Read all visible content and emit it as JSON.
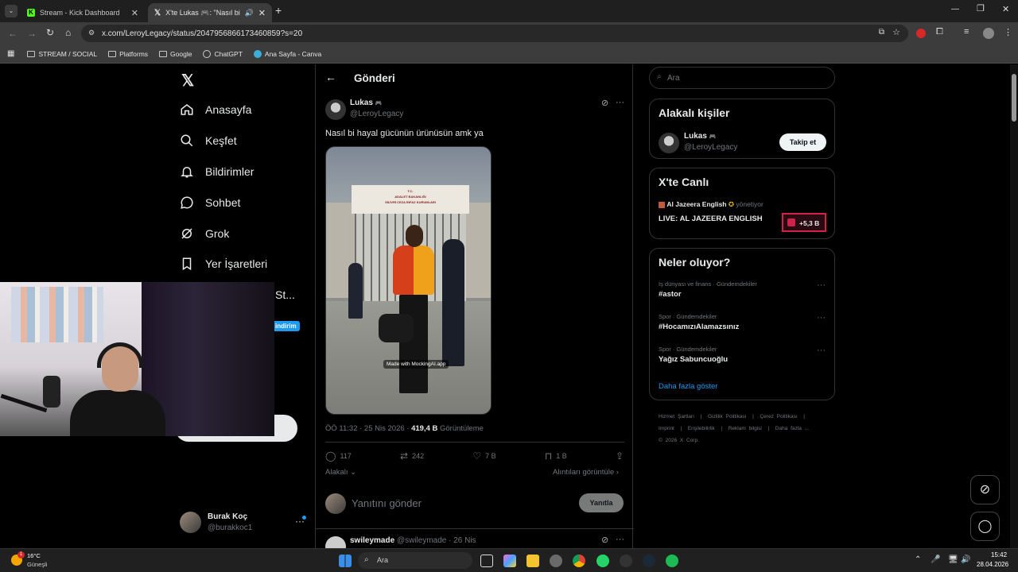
{
  "browser": {
    "tabs": [
      {
        "title": "Stream - Kick Dashboard",
        "active": false
      },
      {
        "title": "X'te Lukas 🎮: \"Nasıl bi hay",
        "active": true
      }
    ],
    "url": "x.com/LeroyLegacy/status/2047956866173460859?s=20",
    "bookmarks": [
      "STREAM / SOCIAL",
      "Platforms",
      "Google",
      "ChatGPT",
      "Ana Sayfa - Canva"
    ]
  },
  "sidebar": {
    "items": [
      {
        "label": "Anasayfa",
        "icon": "home-icon"
      },
      {
        "label": "Keşfet",
        "icon": "search-icon"
      },
      {
        "label": "Bildirimler",
        "icon": "bell-icon"
      },
      {
        "label": "Sohbet",
        "icon": "chat-icon"
      },
      {
        "label": "Grok",
        "icon": "grok-icon"
      },
      {
        "label": "Yer İşaretleri",
        "icon": "bookmark-icon"
      }
    ],
    "partial_label": "St...",
    "discount_badge": "indirim",
    "account": {
      "name": "Burak Koç",
      "handle": "@burakkoc1"
    }
  },
  "post": {
    "header": "Gönderi",
    "author": "Lukas",
    "author_emoji": "🎮",
    "handle": "@LeroyLegacy",
    "text": "Nasıl bi hayal gücünün ürünüsün amk ya",
    "image_sign_lines": [
      "T.C.",
      "ADALET BAKANLIĞI",
      "SİLİVRİ CEZA İNFAZ KURUMLARI"
    ],
    "watermark": "Made with MockingAI.app",
    "time": "ÖÖ 11:32 · 25 Nis 2026 · ",
    "views": "419,4 B",
    "views_label": " Görüntüleme",
    "replies": "117",
    "reposts": "242",
    "likes": "7 B",
    "bookmarks": "1 B",
    "relevant_label": "Alakalı",
    "quotes_label": "Alıntıları görüntüle",
    "reply_placeholder": "Yanıtını gönder",
    "reply_button": "Yanıtla",
    "next_reply": {
      "author": "swileymade",
      "handle": "@swileymade",
      "date": "· 26 Nis"
    }
  },
  "right": {
    "search_placeholder": "Ara",
    "related_title": "Alakalı kişiler",
    "related_person": {
      "name": "Lukas",
      "handle": "@LeroyLegacy",
      "button": "Takip et"
    },
    "live_title": "X'te Canlı",
    "live": {
      "channel": "Al Jazeera English",
      "role": "yönetiyor",
      "title": "LIVE: AL JAZEERA ENGLISH",
      "viewers": "+5,3 B"
    },
    "trends_title": "Neler oluyor?",
    "trends": [
      {
        "category": "İş dünyası ve finans · Gündemdekiler",
        "tag": "#astor"
      },
      {
        "category": "Spor · Gündemdekiler",
        "tag": "#HocamızıAlamazsınız"
      },
      {
        "category": "Spor · Gündemdekiler",
        "tag": "Yağız Sabuncuoğlu"
      }
    ],
    "show_more": "Daha fazla göster",
    "footer_links": [
      "Hizmet Şartları",
      "|",
      "Gizlilik Politikası",
      "|",
      "Çerez Politikası",
      "|",
      "Imprint",
      "|",
      "Erişilebilirlik",
      "|",
      "Reklam bilgisi",
      "|",
      "Daha fazla ..."
    ],
    "copyright": "© 2026 X Corp."
  },
  "taskbar": {
    "weather_temp": "16°C",
    "weather_desc": "Güneşli",
    "weather_badge": "1",
    "search": "Ara",
    "time": "15:42",
    "date": "28.04.2026"
  },
  "colors": {
    "accent": "#1d9bf0",
    "bg": "#000000",
    "border": "#2f3336",
    "muted": "#71767b",
    "live_red": "#d0234a"
  }
}
